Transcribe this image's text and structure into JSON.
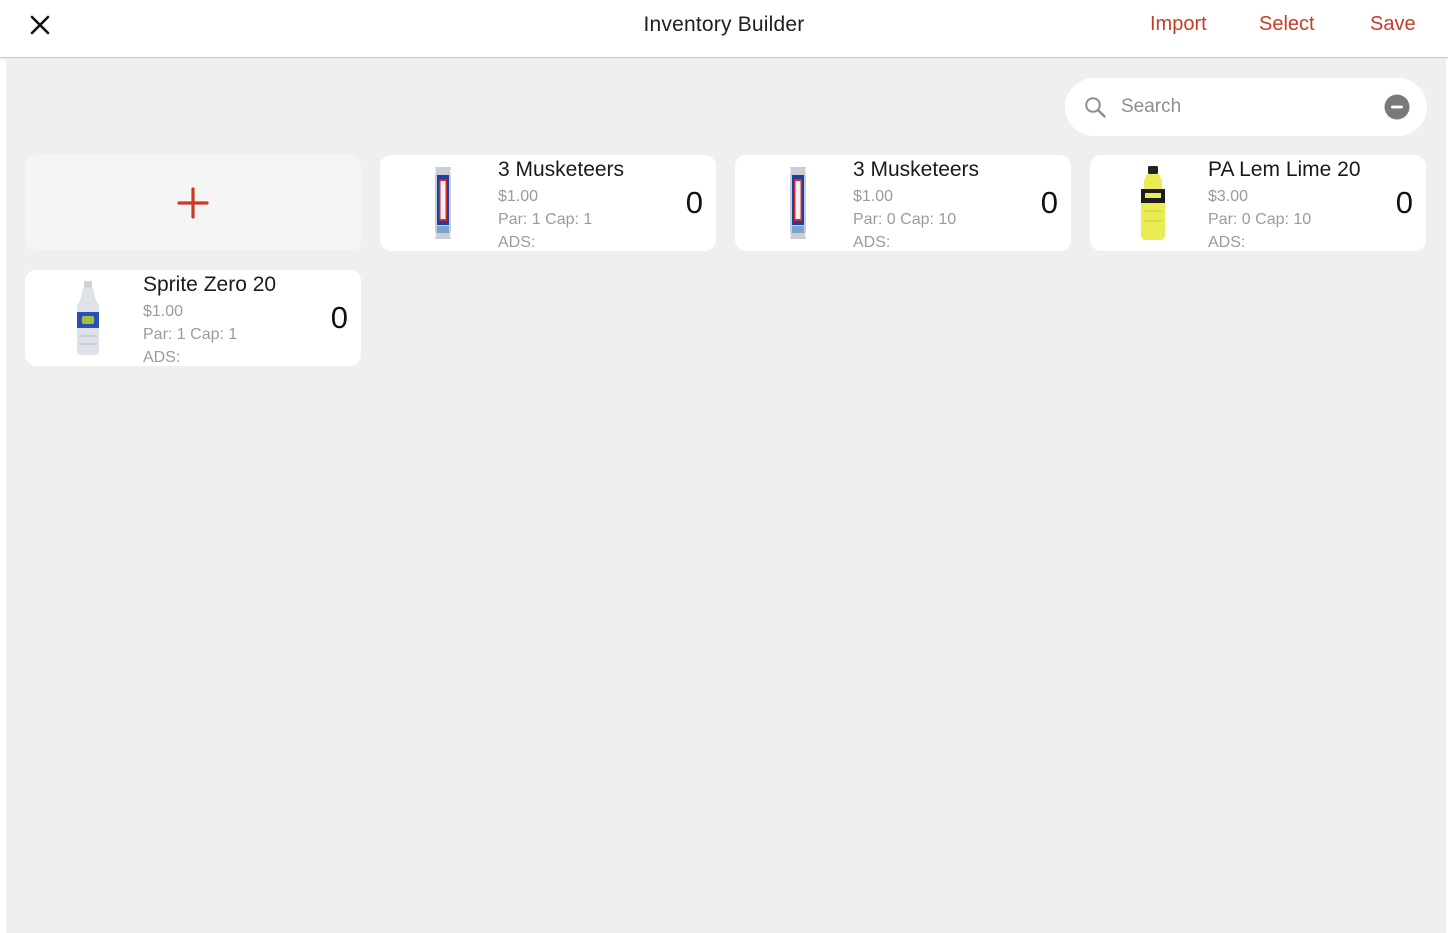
{
  "header": {
    "title": "Inventory Builder",
    "actions": {
      "import": "Import",
      "select": "Select",
      "save": "Save"
    }
  },
  "search": {
    "placeholder": "Search",
    "value": ""
  },
  "colors": {
    "accent": "#c83c25",
    "background": "#efefef",
    "card": "#ffffff",
    "muted_text": "#9b9b9b"
  },
  "items": [
    {
      "name": "3 Musketeers",
      "price": "$1.00",
      "par_cap": "Par: 1 Cap: 1",
      "ads": "ADS:",
      "count": "0",
      "image": "candy-bar-image"
    },
    {
      "name": "3 Musketeers",
      "price": "$1.00",
      "par_cap": "Par: 0 Cap: 10",
      "ads": "ADS:",
      "count": "0",
      "image": "candy-bar-image"
    },
    {
      "name": "PA Lem Lime 20",
      "price": "$3.00",
      "par_cap": "Par: 0 Cap: 10",
      "ads": "ADS:",
      "count": "0",
      "image": "sports-drink-bottle-image"
    },
    {
      "name": "Sprite Zero 20",
      "price": "$1.00",
      "par_cap": "Par: 1 Cap: 1",
      "ads": "ADS:",
      "count": "0",
      "image": "soda-bottle-image"
    }
  ]
}
